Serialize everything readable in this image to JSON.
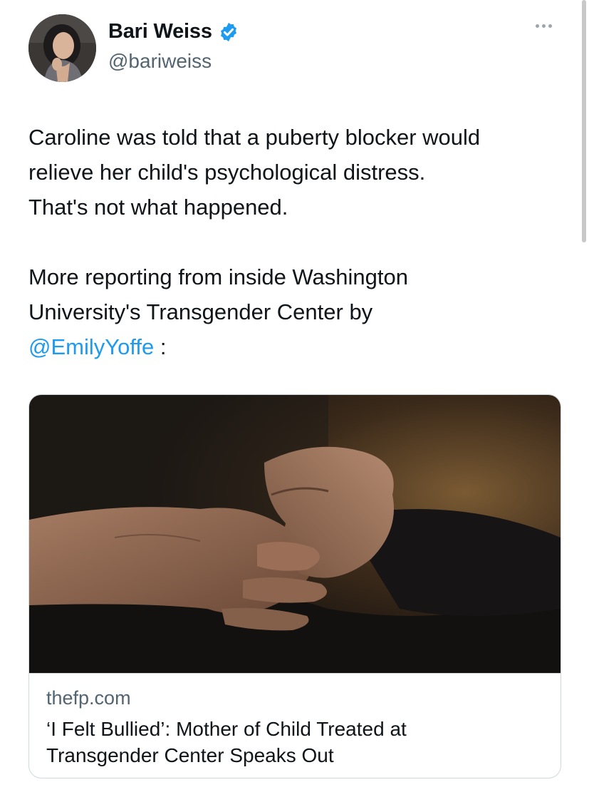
{
  "author": {
    "display_name": "Bari Weiss",
    "handle": "@bariweiss",
    "verified": true,
    "avatar_icon": "profile-photo"
  },
  "menu": {
    "icon": "more-options-icon"
  },
  "tweet": {
    "paragraph1": [
      "Caroline was told that a puberty blocker would",
      "relieve her child's psychological distress.",
      "That's not what happened."
    ],
    "paragraph2": [
      "More reporting from inside Washington",
      "University's Transgender Center by"
    ],
    "mention": "@EmilyYoffe",
    "mention_suffix": " :"
  },
  "card": {
    "image_icon": "clasped-hands-photo",
    "domain": "thefp.com",
    "title_line1": "‘I Felt Bullied’: Mother of Child Treated at",
    "title_line2": "Transgender Center Speaks Out"
  },
  "colors": {
    "text": "#0f1419",
    "secondary": "#536471",
    "link": "#1d9bf0",
    "verified": "#1d9bf0",
    "border": "#cfd9de"
  }
}
